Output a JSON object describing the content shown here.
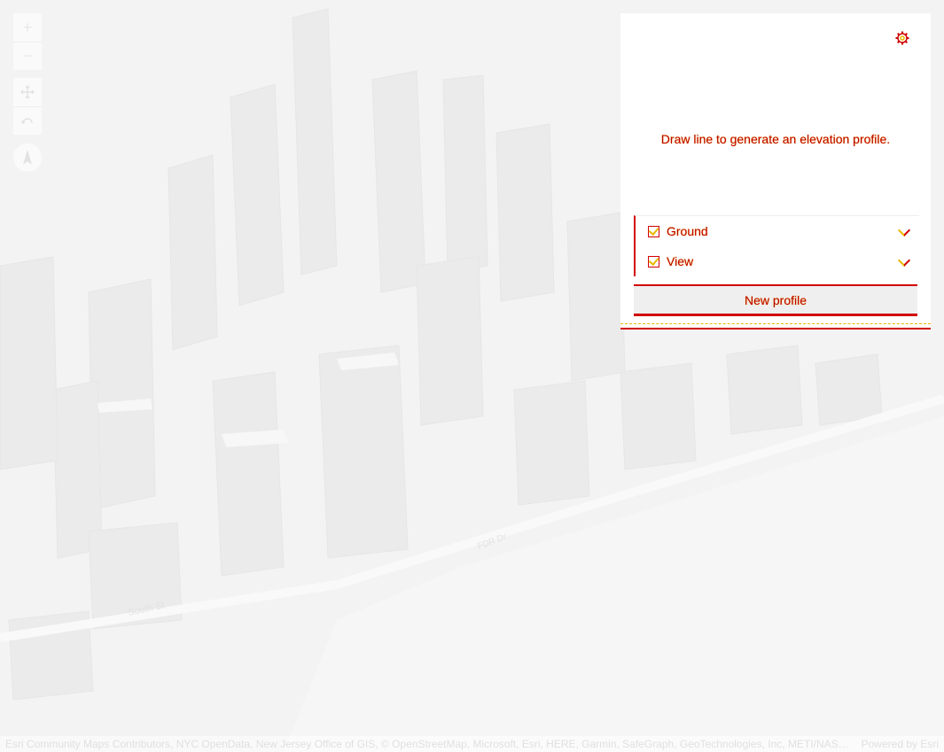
{
  "nav": {
    "zoom_in_symbol": "+",
    "zoom_out_symbol": "−",
    "pan_icon": "move-icon",
    "rotate_icon": "rotate-icon",
    "compass_icon": "compass-icon"
  },
  "map": {
    "street_label_1": "South St",
    "street_label_2": "FDR Dr"
  },
  "elevation_profile": {
    "settings_icon": "gear-icon",
    "hint": "Draw line to generate an elevation profile.",
    "profiles": [
      {
        "label": "Ground",
        "checked": true
      },
      {
        "label": "View",
        "checked": true
      }
    ],
    "new_profile_label": "New profile"
  },
  "attribution": {
    "text": "Esri Community Maps Contributors, NYC OpenData, New Jersey Office of GIS, © OpenStreetMap, Microsoft, Esri, HERE, Garmin, SafeGraph, GeoTechnologies, Inc, METI/NASA...",
    "powered_by": "Powered by Esri"
  },
  "colors": {
    "accent": "#d00000",
    "highlight": "#e8b800",
    "panel_bg": "#ffffff",
    "map_bg": "#f4f4f4"
  }
}
